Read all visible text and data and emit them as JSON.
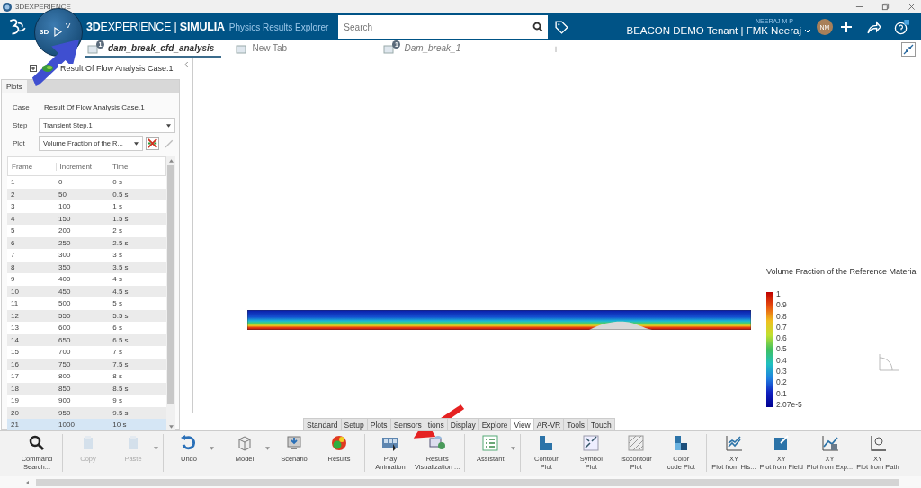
{
  "window": {
    "title": "3DEXPERIENCE"
  },
  "compass": {
    "labels": [
      "3D",
      "V"
    ]
  },
  "top_bar": {
    "brand": "**3D**EXPERIENCE | **SIMULIA**",
    "app_name": "Physics Results Explorer",
    "search": {
      "placeholder": "Search"
    },
    "user_name": "NEERAJ M P",
    "tenant": "BEACON DEMO Tenant | FMK Neeraj",
    "avatar": "NM"
  },
  "tabs": [
    {
      "label": "dam_break_cfd_analysis",
      "selected": true,
      "badge": "1"
    },
    {
      "label": "New Tab",
      "selected": false
    },
    {
      "label": "Dam_break_1",
      "selected": false,
      "badge": "1"
    }
  ],
  "new_tab": "+",
  "tree": {
    "items": [
      {
        "label": "Result Of Flow Analysis Case.1"
      }
    ]
  },
  "plots_panel": {
    "tab": "Plots",
    "fields": [
      {
        "label": "Case",
        "value": "Result Of Flow Analysis Case.1",
        "kind": "text"
      },
      {
        "label": "Step",
        "value": "Transient Step.1",
        "kind": "dropdown"
      },
      {
        "label": "Plot",
        "value": "Volume Fraction of the R...",
        "kind": "dropdown"
      }
    ],
    "table": {
      "columns": [
        "Frame",
        "Increment",
        "Time"
      ],
      "rows": [
        {
          "cells": [
            "1",
            "0",
            "0 s"
          ],
          "selected": false
        },
        {
          "cells": [
            "2",
            "50",
            "0.5 s"
          ],
          "selected": false
        },
        {
          "cells": [
            "3",
            "100",
            "1 s"
          ],
          "selected": false
        },
        {
          "cells": [
            "4",
            "150",
            "1.5 s"
          ],
          "selected": false
        },
        {
          "cells": [
            "5",
            "200",
            "2 s"
          ],
          "selected": false
        },
        {
          "cells": [
            "6",
            "250",
            "2.5 s"
          ],
          "selected": false
        },
        {
          "cells": [
            "7",
            "300",
            "3 s"
          ],
          "selected": false
        },
        {
          "cells": [
            "8",
            "350",
            "3.5 s"
          ],
          "selected": false
        },
        {
          "cells": [
            "9",
            "400",
            "4 s"
          ],
          "selected": false
        },
        {
          "cells": [
            "10",
            "450",
            "4.5 s"
          ],
          "selected": false
        },
        {
          "cells": [
            "11",
            "500",
            "5 s"
          ],
          "selected": false
        },
        {
          "cells": [
            "12",
            "550",
            "5.5 s"
          ],
          "selected": false
        },
        {
          "cells": [
            "13",
            "600",
            "6 s"
          ],
          "selected": false
        },
        {
          "cells": [
            "14",
            "650",
            "6.5 s"
          ],
          "selected": false
        },
        {
          "cells": [
            "15",
            "700",
            "7 s"
          ],
          "selected": false
        },
        {
          "cells": [
            "16",
            "750",
            "7.5 s"
          ],
          "selected": false
        },
        {
          "cells": [
            "17",
            "800",
            "8 s"
          ],
          "selected": false
        },
        {
          "cells": [
            "18",
            "850",
            "8.5 s"
          ],
          "selected": false
        },
        {
          "cells": [
            "19",
            "900",
            "9 s"
          ],
          "selected": false
        },
        {
          "cells": [
            "20",
            "950",
            "9.5 s"
          ],
          "selected": false
        },
        {
          "cells": [
            "21",
            "1000",
            "10 s"
          ],
          "selected": true
        }
      ]
    }
  },
  "legend": {
    "title": "Volume Fraction of the Reference Material",
    "labels": [
      "1",
      "0.9",
      "0.8",
      "0.7",
      "0.6",
      "0.5",
      "0.4",
      "0.3",
      "0.2",
      "0.1",
      "2.07e-5"
    ]
  },
  "ribbon": {
    "tabs": [
      {
        "label": "Standard",
        "selected": false
      },
      {
        "label": "Setup",
        "selected": false
      },
      {
        "label": "Plots",
        "selected": false
      },
      {
        "label": "Sensors",
        "selected": false
      },
      {
        "label": "tions",
        "selected": false
      },
      {
        "label": "Display",
        "selected": false
      },
      {
        "label": "Explore",
        "selected": false
      },
      {
        "label": "View",
        "selected": true
      },
      {
        "label": "AR-VR",
        "selected": false
      },
      {
        "label": "Tools",
        "selected": false
      },
      {
        "label": "Touch",
        "selected": false
      }
    ],
    "commands": [
      {
        "lines": [
          "Command",
          "Search..."
        ],
        "disabled": false,
        "dropdown": false,
        "separator_before": false
      },
      {
        "lines": [
          "Copy"
        ],
        "disabled": true,
        "dropdown": false,
        "separator_before": true
      },
      {
        "lines": [
          "Paste"
        ],
        "disabled": true,
        "dropdown": true,
        "separator_before": false
      },
      {
        "lines": [
          "Undo"
        ],
        "disabled": false,
        "dropdown": true,
        "separator_before": true
      },
      {
        "lines": [
          "Model"
        ],
        "disabled": false,
        "dropdown": true,
        "separator_before": true
      },
      {
        "lines": [
          "Scenario"
        ],
        "disabled": false,
        "dropdown": false,
        "separator_before": false
      },
      {
        "lines": [
          "Results"
        ],
        "disabled": false,
        "dropdown": false,
        "separator_before": false
      },
      {
        "lines": [
          "Play",
          "Animation"
        ],
        "disabled": false,
        "dropdown": false,
        "separator_before": true
      },
      {
        "lines": [
          "Results",
          "Visualization ..."
        ],
        "disabled": false,
        "dropdown": false,
        "separator_before": false
      },
      {
        "lines": [
          "Assistant"
        ],
        "disabled": false,
        "dropdown": true,
        "separator_before": true
      },
      {
        "lines": [
          "Contour",
          "Plot"
        ],
        "disabled": false,
        "dropdown": false,
        "separator_before": true
      },
      {
        "lines": [
          "Symbol",
          "Plot"
        ],
        "disabled": false,
        "dropdown": false,
        "separator_before": false
      },
      {
        "lines": [
          "Isocontour",
          "Plot"
        ],
        "disabled": false,
        "dropdown": false,
        "separator_before": false
      },
      {
        "lines": [
          "Color",
          "code Plot"
        ],
        "disabled": false,
        "dropdown": false,
        "separator_before": false
      },
      {
        "lines": [
          "XY",
          "Plot from His..."
        ],
        "disabled": false,
        "dropdown": false,
        "separator_before": true
      },
      {
        "lines": [
          "XY",
          "Plot from Field"
        ],
        "disabled": false,
        "dropdown": false,
        "separator_before": false
      },
      {
        "lines": [
          "XY",
          "Plot from Exp..."
        ],
        "disabled": false,
        "dropdown": false,
        "separator_before": false
      },
      {
        "lines": [
          "XY",
          "Plot from Path"
        ],
        "disabled": false,
        "dropdown": false,
        "separator_before": false
      }
    ]
  }
}
